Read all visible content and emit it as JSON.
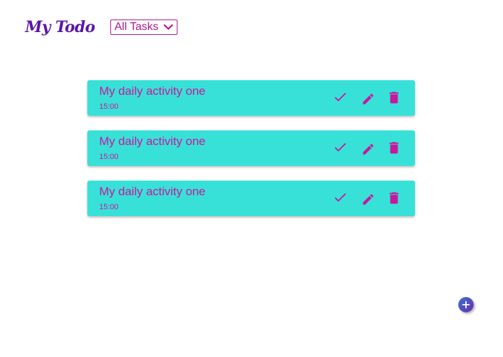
{
  "app": {
    "title": "My Todo",
    "brand_color": "#5a16a8"
  },
  "filter": {
    "selected": "All Tasks",
    "icon": "chevron-down-icon",
    "color": "#b0168c"
  },
  "todos": [
    {
      "title": "My daily activity one",
      "time": "15:00"
    },
    {
      "title": "My daily activity one",
      "time": "15:00"
    },
    {
      "title": "My daily activity one",
      "time": "15:00"
    }
  ],
  "todo_actions": {
    "complete_icon": "check-icon",
    "edit_icon": "pencil-icon",
    "delete_icon": "trash-icon"
  },
  "colors": {
    "card_background": "#38e1d8",
    "accent": "#c9179e",
    "fab_start": "#3b6fd0",
    "fab_end": "#6a2fb0"
  },
  "fab": {
    "icon": "plus-icon"
  }
}
